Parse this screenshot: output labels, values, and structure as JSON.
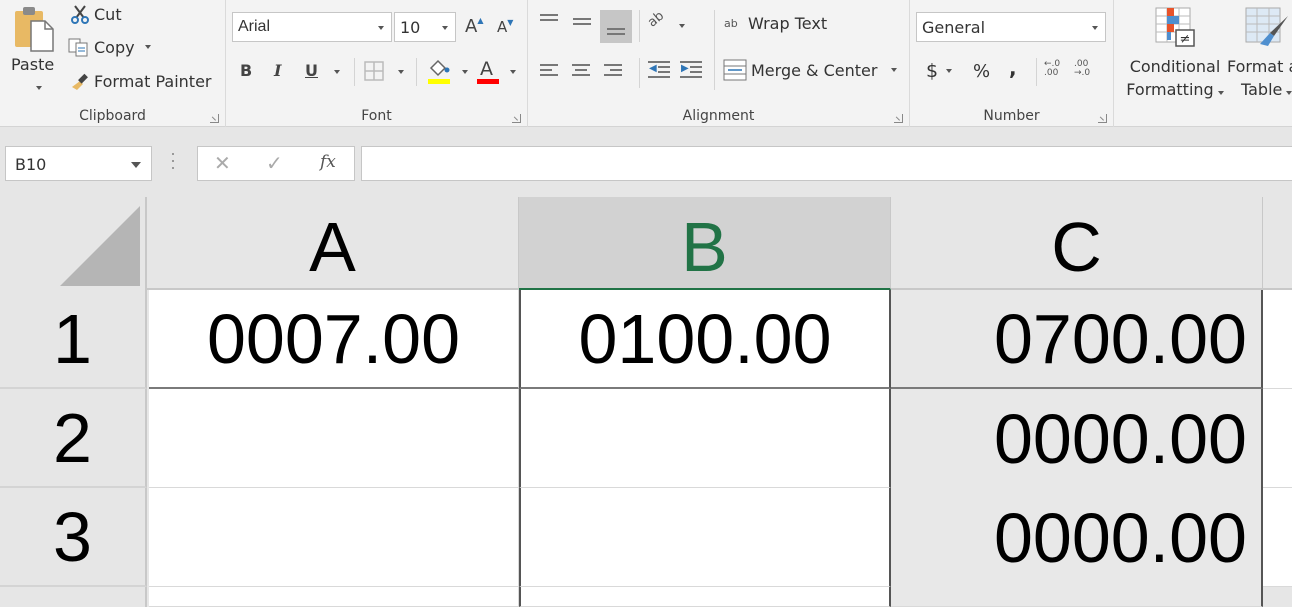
{
  "ribbon": {
    "clipboard": {
      "label": "Clipboard",
      "paste": "Paste",
      "cut": "Cut",
      "copy": "Copy",
      "format_painter": "Format Painter"
    },
    "font": {
      "label": "Font",
      "font_name": "Arial",
      "font_size": "10",
      "grow": "A",
      "shrink": "A",
      "bold": "B",
      "italic": "I",
      "underline": "U",
      "font_color_glyph": "A",
      "fill_color": "#ffff00",
      "font_color": "#ff0000"
    },
    "alignment": {
      "label": "Alignment",
      "wrap_text": "Wrap Text",
      "merge_center": "Merge & Center",
      "orientation_glyph": "ab",
      "wrap_glyph": "ab"
    },
    "number": {
      "label": "Number",
      "format": "General",
      "currency": "$",
      "percent": "%",
      "comma": ",",
      "increase_decimal": "←.0 .00",
      "decrease_decimal": ".00 →.0"
    },
    "styles": {
      "conditional_formatting_line1": "Conditional",
      "conditional_formatting_line2": "Formatting",
      "format_as_table_line1": "Format as",
      "format_as_table_line2": "Table"
    }
  },
  "formula_bar": {
    "name_box": "B10",
    "cancel": "✕",
    "enter": "✓",
    "fx": "fx",
    "value": ""
  },
  "sheet": {
    "columns": [
      "A",
      "B",
      "C"
    ],
    "selected_column": "B",
    "rows": [
      {
        "num": "1",
        "cells": [
          "0007.00",
          "0100.00",
          "0700.00"
        ]
      },
      {
        "num": "2",
        "cells": [
          "",
          "",
          "0000.00"
        ]
      },
      {
        "num": "3",
        "cells": [
          "",
          "",
          "0000.00"
        ]
      }
    ]
  },
  "colors": {
    "accent": "#217346",
    "selected_header": "#d2d2d2"
  }
}
